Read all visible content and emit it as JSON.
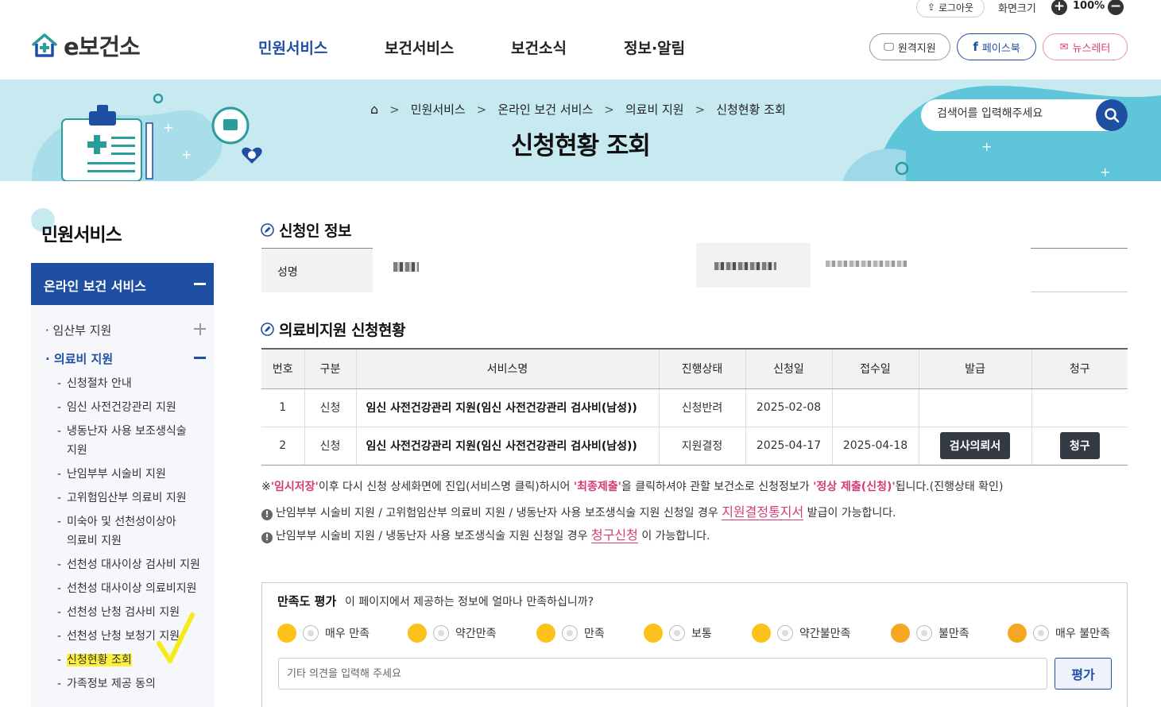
{
  "utility": {
    "logout_label": "로그아웃",
    "screen_size_label": "화면크기",
    "zoom_value": "100%",
    "zoom_in_symbol": "+",
    "zoom_out_symbol": "−"
  },
  "header": {
    "logo_text": "e보건소",
    "nav": [
      {
        "label": "민원서비스",
        "active": true
      },
      {
        "label": "보건서비스",
        "active": false
      },
      {
        "label": "보건소식",
        "active": false
      },
      {
        "label": "정보·알림",
        "active": false
      }
    ],
    "buttons": {
      "remote": "원격지원",
      "facebook": "페이스북",
      "newsletter": "뉴스레터"
    }
  },
  "banner": {
    "breadcrumb": [
      "민원서비스",
      "온라인 보건 서비스",
      "의료비 지원",
      "신청현황 조회"
    ],
    "page_title": "신청현황 조회",
    "search_placeholder": "검색어를 입력해주세요"
  },
  "sidebar": {
    "title": "민원서비스",
    "section": "온라인 보건 서비스",
    "groups": [
      {
        "label": "임산부 지원",
        "expanded": false
      },
      {
        "label": "의료비 지원",
        "expanded": true
      }
    ],
    "subitems": [
      {
        "label": "신청절차 안내"
      },
      {
        "label": "임신 사전건강관리 지원"
      },
      {
        "label": "냉동난자 사용 보조생식술",
        "label2": "지원"
      },
      {
        "label": "난임부부 시술비 지원"
      },
      {
        "label": "고위험임산부 의료비 지원"
      },
      {
        "label": "미숙아 및 선천성이상아",
        "label2": "의료비 지원"
      },
      {
        "label": "선천성 대사이상 검사비 지원"
      },
      {
        "label": "선천성 대사이상 의료비지원"
      },
      {
        "label": "선천성 난청 검사비 지원"
      },
      {
        "label": "선천성 난청 보청기 지원"
      },
      {
        "label": "신청현황 조회",
        "current": true
      },
      {
        "label": "가족정보 제공 동의"
      }
    ]
  },
  "applicant": {
    "section_title": "신청인 정보",
    "name_label": "성명"
  },
  "status": {
    "section_title": "의료비지원 신청현황",
    "columns": [
      "번호",
      "구분",
      "서비스명",
      "진행상태",
      "신청일",
      "접수일",
      "발급",
      "청구"
    ],
    "rows": [
      {
        "no": "1",
        "type": "신청",
        "service": "임신 사전건강관리 지원(임신 사전건강관리 검사비(남성))",
        "state": "신청반려",
        "applied": "2025-02-08",
        "received": "",
        "issue": "",
        "claim": ""
      },
      {
        "no": "2",
        "type": "신청",
        "service": "임신 사전건강관리 지원(임신 사전건강관리 검사비(남성))",
        "state": "지원결정",
        "applied": "2025-04-17",
        "received": "2025-04-18",
        "issue": "검사의뢰서",
        "claim": "청구"
      }
    ]
  },
  "notes": {
    "n1_a": "※",
    "n1_b": "'임시저장'",
    "n1_c": "이후 다시 신청 상세화면에 진입(서비스명 클릭)하시어 ",
    "n1_d": "'최종제출'",
    "n1_e": "을 클릭하셔야 관할 보건소로 신청정보가 ",
    "n1_f": "'정상 제출(신청)'",
    "n1_g": "됩니다.(진행상태 확인)",
    "n2_a": "난임부부 시술비 지원 / 고위험임산부 의료비 지원 / 냉동난자 사용 보조생식술 지원 신청일 경우 ",
    "n2_b": "지원결정통지서",
    "n2_c": " 발급이 가능합니다.",
    "n3_a": "난임부부 시술비 지원 / 냉동난자 사용 보조생식술 지원 신청일 경우 ",
    "n3_b": "청구신청",
    "n3_c": " 이 가능합니다.",
    "excl_symbol": "!"
  },
  "satisfaction": {
    "title": "만족도 평가",
    "question": "이 페이지에서 제공하는 정보에 얼마나 만족하십니까?",
    "options": [
      "매우 만족",
      "약간만족",
      "만족",
      "보통",
      "약간불만족",
      "불만족",
      "매우 불만족"
    ],
    "input_placeholder": "기타 의견을 입력해 주세요",
    "submit_label": "평가"
  },
  "colors": {
    "brand_blue": "#1f4fa3",
    "banner_bg": "#c7eaf1",
    "accent_pink": "#d43c78",
    "highlight_yellow": "#fdf03c"
  }
}
